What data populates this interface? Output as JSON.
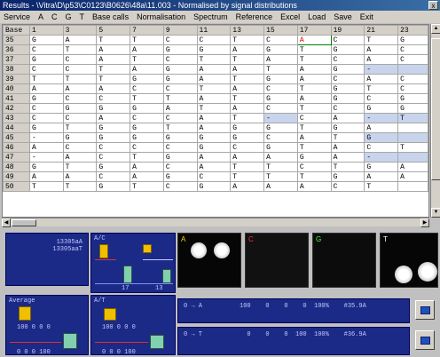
{
  "window": {
    "title": "Results - \\Vitra\\D\\p53\\C0123\\B0626\\48a\\11.003 - Normalised by signal distributions",
    "close_glyph": "x"
  },
  "menu": [
    "Service",
    "A",
    "C",
    "G",
    "T",
    "Base calls",
    "Normalisation",
    "Spectrum",
    "Reference",
    "Excel",
    "Load",
    "Save",
    "Exit"
  ],
  "grid": {
    "headers": [
      "Base",
      "1",
      "3",
      "5",
      "7",
      "9",
      "11",
      "13",
      "15",
      "17",
      "19",
      "21",
      "23"
    ],
    "rows": [
      {
        "base": "35",
        "cells": [
          "G",
          "A",
          "T",
          "T",
          "C",
          "C",
          "T",
          "C",
          "A",
          "C",
          "T",
          "G"
        ]
      },
      {
        "base": "36",
        "cells": [
          "C",
          "T",
          "A",
          "A",
          "G",
          "G",
          "A",
          "G",
          "T",
          "G",
          "A",
          "C"
        ]
      },
      {
        "base": "37",
        "cells": [
          "G",
          "C",
          "A",
          "T",
          "C",
          "T",
          "T",
          "A",
          "T",
          "C",
          "A",
          "C"
        ]
      },
      {
        "base": "38",
        "cells": [
          "C",
          "C",
          "T",
          "A",
          "G",
          "A",
          "A",
          "T",
          "A",
          "G",
          "-",
          ""
        ]
      },
      {
        "base": "39",
        "cells": [
          "T",
          "T",
          "T",
          "G",
          "G",
          "A",
          "T",
          "G",
          "A",
          "C",
          "A",
          "C"
        ]
      },
      {
        "base": "40",
        "cells": [
          "A",
          "A",
          "A",
          "C",
          "C",
          "T",
          "A",
          "C",
          "T",
          "G",
          "T",
          "C"
        ]
      },
      {
        "base": "41",
        "cells": [
          "G",
          "C",
          "C",
          "T",
          "T",
          "A",
          "T",
          "G",
          "A",
          "G",
          "C",
          "G"
        ]
      },
      {
        "base": "42",
        "cells": [
          "C",
          "G",
          "G",
          "G",
          "A",
          "T",
          "A",
          "C",
          "T",
          "C",
          "G",
          "G"
        ]
      },
      {
        "base": "43",
        "cells": [
          "C",
          "C",
          "A",
          "C",
          "C",
          "A",
          "T",
          "-",
          "C",
          "A",
          "-",
          "T"
        ]
      },
      {
        "base": "44",
        "cells": [
          "G",
          "T",
          "G",
          "G",
          "T",
          "A",
          "G",
          "G",
          "T",
          "G",
          "A",
          ""
        ]
      },
      {
        "base": "45",
        "cells": [
          "-",
          "G",
          "G",
          "G",
          "G",
          "G",
          "G",
          "C",
          "A",
          "T",
          "G",
          ""
        ]
      },
      {
        "base": "46",
        "cells": [
          "A",
          "C",
          "C",
          "C",
          "C",
          "G",
          "C",
          "G",
          "T",
          "A",
          "C",
          "T"
        ]
      },
      {
        "base": "47",
        "cells": [
          "-",
          "A",
          "C",
          "T",
          "G",
          "A",
          "A",
          "A",
          "G",
          "A",
          "-",
          ""
        ]
      },
      {
        "base": "48",
        "cells": [
          "G",
          "T",
          "G",
          "A",
          "C",
          "A",
          "T",
          "T",
          "C",
          "T",
          "G",
          "A"
        ]
      },
      {
        "base": "49",
        "cells": [
          "A",
          "A",
          "C",
          "A",
          "G",
          "C",
          "T",
          "T",
          "T",
          "G",
          "A",
          "A"
        ]
      },
      {
        "base": "50",
        "cells": [
          "T",
          "T",
          "G",
          "T",
          "C",
          "G",
          "A",
          "A",
          "A",
          "C",
          "T",
          ""
        ]
      }
    ]
  },
  "panels": {
    "counts": {
      "line1": "13305aA",
      "line2": "13305aaT"
    },
    "bases_panel": {
      "label": "A/C",
      "ticks": [
        "17",
        "13"
      ]
    },
    "images": [
      {
        "label": "A",
        "color": "#ffd200"
      },
      {
        "label": "C",
        "color": "#ff3030"
      },
      {
        "label": "G",
        "color": "#40ff40"
      },
      {
        "label": "T",
        "color": "#ffffff"
      }
    ],
    "average": {
      "label": "Average",
      "row1": "100  0  0  0",
      "row2": "0  0  0  100"
    },
    "at_panel": {
      "label": "A/T",
      "row1": "100  0  0  0",
      "row2": "0  0  0  100"
    },
    "result_a": "0 → A          100    0    0    0  100%    #35.9A",
    "result_t": "0 → T            0    0    0  100  100%    #36.9A"
  },
  "colors": {
    "titlebar": "#0a246a",
    "panel": "#1a2a86",
    "selected_cell_text": "#e00000",
    "highlight_cell": "#c8d4ec"
  }
}
